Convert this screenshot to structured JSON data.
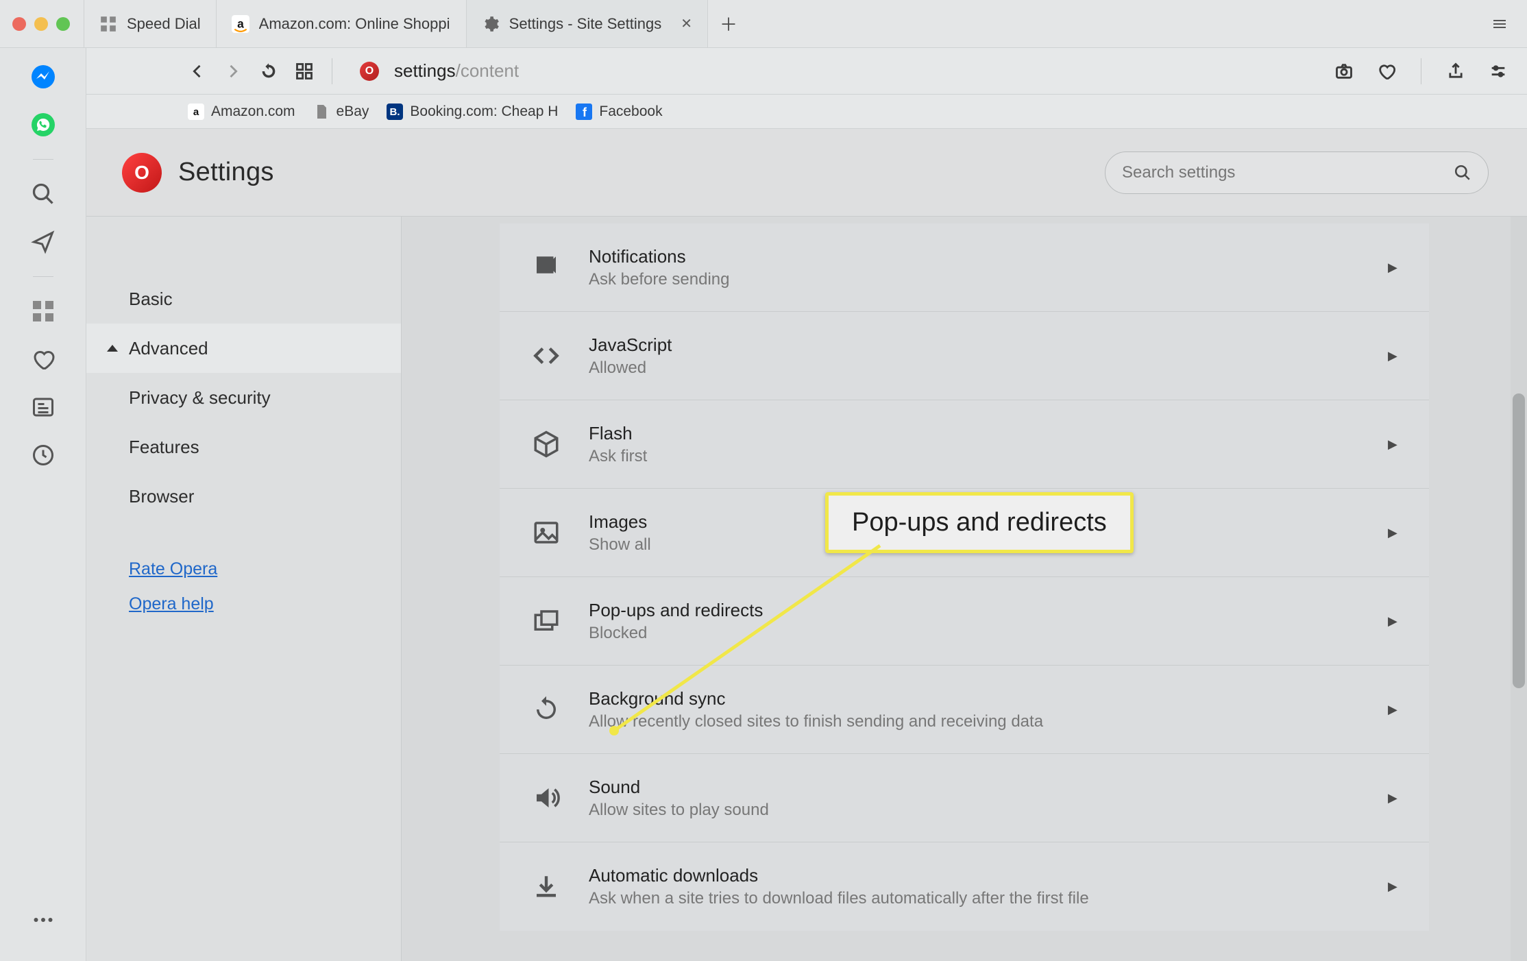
{
  "window": {
    "tabs": [
      {
        "label": "Speed Dial"
      },
      {
        "label": "Amazon.com: Online Shoppin"
      },
      {
        "label": "Settings - Site Settings"
      }
    ]
  },
  "address": {
    "host": "settings",
    "path": "/content"
  },
  "bookmarks": [
    {
      "label": "Amazon.com"
    },
    {
      "label": "eBay"
    },
    {
      "label": "Booking.com: Cheap H"
    },
    {
      "label": "Facebook"
    }
  ],
  "page": {
    "title": "Settings",
    "search_placeholder": "Search settings"
  },
  "nav": {
    "basic": "Basic",
    "advanced": "Advanced",
    "items": [
      {
        "label": "Privacy & security"
      },
      {
        "label": "Features"
      },
      {
        "label": "Browser"
      }
    ],
    "links": {
      "rate": "Rate Opera",
      "help": "Opera help"
    }
  },
  "settings": [
    {
      "title": "Notifications",
      "sub": "Ask before sending"
    },
    {
      "title": "JavaScript",
      "sub": "Allowed"
    },
    {
      "title": "Flash",
      "sub": "Ask first"
    },
    {
      "title": "Images",
      "sub": "Show all"
    },
    {
      "title": "Pop-ups and redirects",
      "sub": "Blocked"
    },
    {
      "title": "Background sync",
      "sub": "Allow recently closed sites to finish sending and receiving data"
    },
    {
      "title": "Sound",
      "sub": "Allow sites to play sound"
    },
    {
      "title": "Automatic downloads",
      "sub": "Ask when a site tries to download files automatically after the first file"
    }
  ],
  "callout": {
    "text": "Pop-ups and redirects"
  }
}
